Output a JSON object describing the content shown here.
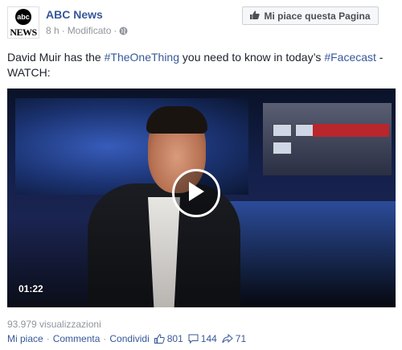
{
  "post": {
    "page_name": "ABC News",
    "time": "8 h",
    "edited": "Modificato",
    "meta_sep": "·",
    "avatar_logo_circle": "abc",
    "avatar_logo_word": "NEWS",
    "like_page_label": "Mi piace questa Pagina",
    "text_before": "David Muir has the ",
    "hashtag1": "#TheOneThing",
    "text_middle": " you need to know in today’s ",
    "hashtag2": "#Facecast",
    "text_after": " - WATCH:"
  },
  "video": {
    "duration": "01:22"
  },
  "footer": {
    "views": "93.979 visualizzazioni",
    "like": "Mi piace",
    "comment": "Commenta",
    "share": "Condividi",
    "sep": "·",
    "likes_count": "801",
    "comments_count": "144",
    "shares_count": "71"
  },
  "colors": {
    "link": "#365899",
    "meta": "#90949c",
    "text": "#1d2129"
  }
}
